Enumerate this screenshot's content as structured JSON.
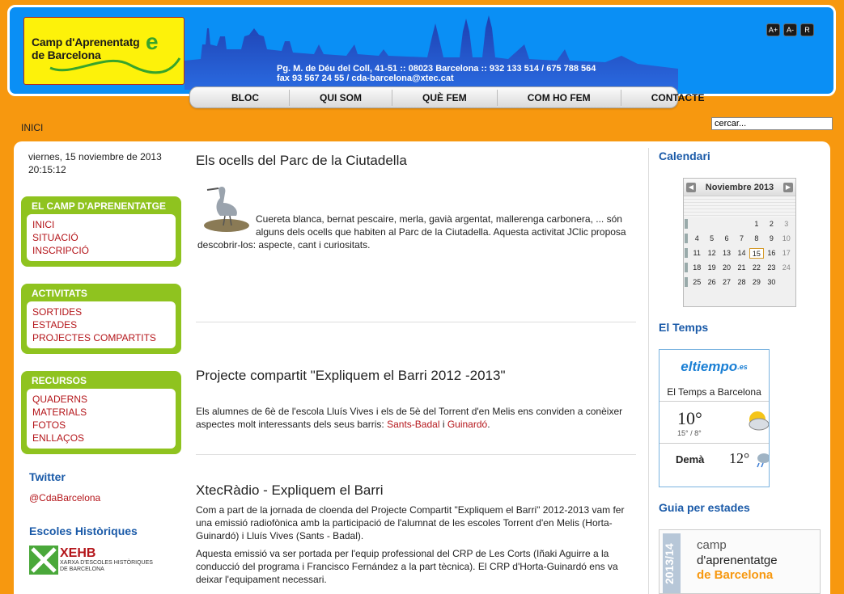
{
  "header": {
    "logo_line1": "Camp d'Aprenentatg",
    "logo_line2": "de Barcelona",
    "logo_e": "e",
    "address_line1": "Pg. M. de Déu del Coll, 41-51 :: 08023 Barcelona :: 932 133 514 / 675 788 564",
    "address_line2": "fax 93 567 24 55 / cda-barcelona@xtec.cat",
    "font_buttons": [
      "A+",
      "A-",
      "R"
    ]
  },
  "nav": {
    "items": [
      "BLOC",
      "QUI SOM",
      "QUÈ FEM",
      "COM HO FEM",
      "CONTACTE"
    ]
  },
  "breadcrumb": "INICI",
  "search": {
    "value": "cercar..."
  },
  "sidebar": {
    "date": "viernes, 15 noviembre de 2013",
    "time": "20:15:12",
    "blocks": [
      {
        "title": "EL CAMP D'APRENENTATGE",
        "links": [
          "INICI",
          "SITUACIÓ",
          "INSCRIPCIÓ"
        ]
      },
      {
        "title": "ACTIVITATS",
        "links": [
          "SORTIDES",
          "ESTADES",
          "PROJECTES COMPARTITS"
        ]
      },
      {
        "title": "RECURSOS",
        "links": [
          "QUADERNS",
          "MATERIALS",
          "FOTOS",
          "ENLLAÇOS"
        ]
      }
    ],
    "twitter_title": "Twitter",
    "twitter_handle": "@CdaBarcelona",
    "schools_title": "Escoles Històriques",
    "xehb_name": "XEHB",
    "xehb_sub1": "XARXA D'ESCOLES HISTÒRIQUES",
    "xehb_sub2": "DE BARCELONA"
  },
  "articles": [
    {
      "title": "Els ocells del Parc de la Ciutadella",
      "text": "Cuereta blanca, bernat pescaire, merla, gavià argentat, mallerenga carbonera, ... són alguns dels ocells que habiten al Parc de la Ciutadella. Aquesta activitat JClic proposa descobrir-los: aspecte, cant i curiositats."
    },
    {
      "title": "Projecte compartit \"Expliquem el Barri 2012 -2013\"",
      "text_before": "Els alumnes de 6è de  l'escola Lluís Vives   i els de 5è del Torrent d'en Melis  ens conviden a conèixer aspectes molt interessants  dels seus barris:  ",
      "link1": "Sants-Badal",
      "text_mid": "  i ",
      "link2": "Guinardó",
      "text_after": "."
    },
    {
      "title": "XtecRàdio - Expliquem el Barri",
      "p1": "Com a part de la jornada de cloenda del Projecte Compartit \"Expliquem el Barri\" 2012-2013 vam fer una emissió radiofònica amb la participació de l'alumnat de les escoles Torrent d'en Melis (Horta-Guinardó) i Lluís Vives (Sants - Badal).",
      "p2": "Aquesta emissió va ser portada per l'equip professional del CRP de Les Corts (Iñaki Aguirre a la conducció del programa i Francisco Fernández a la part tècnica). El CRP d'Horta-Guinardó ens va deixar l'equipament necessari."
    }
  ],
  "right": {
    "calendar_title": "Calendari",
    "calendar": {
      "month": "Noviembre 2013",
      "prev": "◀",
      "next": "▶",
      "weeks": [
        [
          "",
          "",
          "",
          "",
          "1",
          "2",
          "3"
        ],
        [
          "4",
          "5",
          "6",
          "7",
          "8",
          "9",
          "10"
        ],
        [
          "11",
          "12",
          "13",
          "14",
          "15",
          "16",
          "17"
        ],
        [
          "18",
          "19",
          "20",
          "21",
          "22",
          "23",
          "24"
        ],
        [
          "25",
          "26",
          "27",
          "28",
          "29",
          "30",
          ""
        ]
      ],
      "today": "15"
    },
    "weather_title": "El Temps",
    "weather": {
      "brand": "eltiempo",
      "brand_tld": ".es",
      "place": "El Temps a Barcelona",
      "temp": "10°",
      "minmax": "15° / 8°",
      "tomorrow_label": "Demà",
      "tomorrow_temp": "12°"
    },
    "guide_title": "Guia per estades",
    "guide": {
      "year": "2013/14",
      "line1": "camp",
      "line2": "d'aprenentatge",
      "line3": "de Barcelona"
    }
  },
  "colors": {
    "orange": "#f7980f",
    "blue": "#0a8ff5",
    "green": "#8fc31f",
    "link_red": "#b4151a",
    "title_blue": "#1a5aa8"
  }
}
